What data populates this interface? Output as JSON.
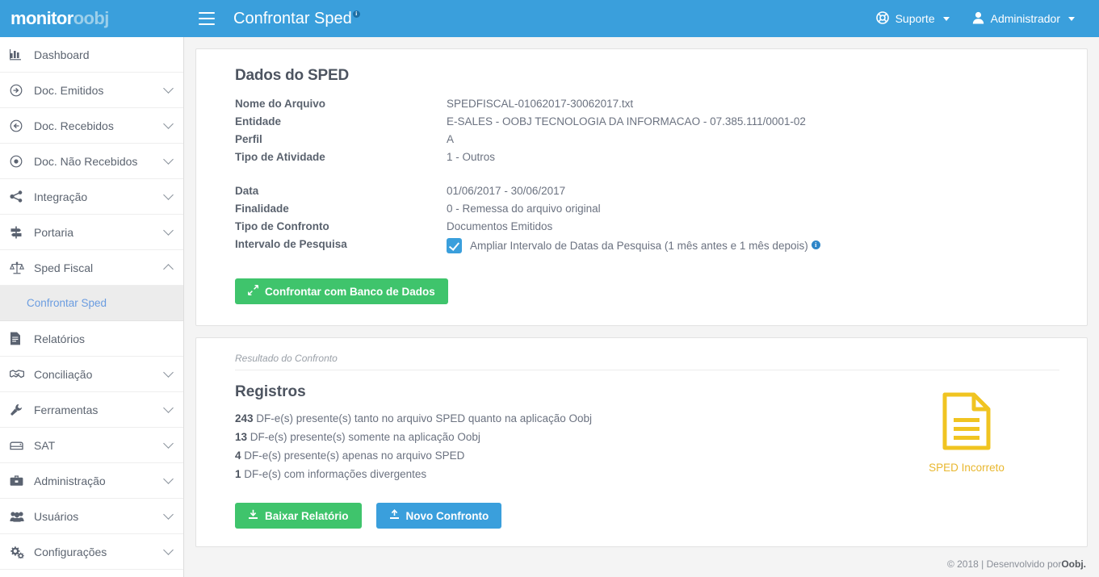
{
  "brand": {
    "part1": "monitor",
    "part2": "oobj"
  },
  "header": {
    "menu_icon": "hamburger-icon",
    "page_title": "Confrontar Sped",
    "title_info_badge": "i",
    "support_label": "Suporte",
    "support_icon": "life-ring-icon",
    "user_label": "Administrador",
    "user_icon": "user-icon",
    "accent_color": "#3a9fdc"
  },
  "sidebar": {
    "items": [
      {
        "label": "Dashboard",
        "icon": "bar-chart-icon",
        "expandable": false
      },
      {
        "label": "Doc. Emitidos",
        "icon": "arrow-circle-right-icon",
        "expandable": true
      },
      {
        "label": "Doc. Recebidos",
        "icon": "arrow-circle-left-icon",
        "expandable": true
      },
      {
        "label": "Doc. Não Recebidos",
        "icon": "dot-circle-icon",
        "expandable": true
      },
      {
        "label": "Integração",
        "icon": "share-nodes-icon",
        "expandable": true
      },
      {
        "label": "Portaria",
        "icon": "signpost-icon",
        "expandable": true
      },
      {
        "label": "Sped Fiscal",
        "icon": "balance-scale-icon",
        "expandable": true,
        "expanded": true
      },
      {
        "label": "Relatórios",
        "icon": "file-lines-icon",
        "expandable": false
      },
      {
        "label": "Conciliação",
        "icon": "handshake-icon",
        "expandable": true
      },
      {
        "label": "Ferramentas",
        "icon": "wrench-icon",
        "expandable": true
      },
      {
        "label": "SAT",
        "icon": "printer-icon",
        "expandable": true
      },
      {
        "label": "Administração",
        "icon": "briefcase-icon",
        "expandable": true
      },
      {
        "label": "Usuários",
        "icon": "users-icon",
        "expandable": true
      },
      {
        "label": "Configurações",
        "icon": "gears-icon",
        "expandable": true
      }
    ],
    "active_sub_item": "Confrontar Sped"
  },
  "sped_card": {
    "title": "Dados do SPED",
    "fields_group1": [
      {
        "label": "Nome do Arquivo",
        "value": "SPEDFISCAL-01062017-30062017.txt"
      },
      {
        "label": "Entidade",
        "value": "E-SALES - OOBJ TECNOLOGIA DA INFORMACAO - 07.385.111/0001-02"
      },
      {
        "label": "Perfil",
        "value": "A"
      },
      {
        "label": "Tipo de Atividade",
        "value": "1 - Outros"
      }
    ],
    "fields_group2": [
      {
        "label": "Data",
        "value": "01/06/2017 - 30/06/2017"
      },
      {
        "label": "Finalidade",
        "value": "0 - Remessa do arquivo original"
      },
      {
        "label": "Tipo de Confronto",
        "value": "Documentos Emitidos"
      }
    ],
    "interval_label": "Intervalo de Pesquisa",
    "interval_checkbox_checked": true,
    "interval_checkbox_text": "Ampliar Intervalo de Datas da Pesquisa (1 mês antes e 1 mês depois)",
    "interval_info_badge": "i",
    "confront_button": {
      "label": "Confrontar com Banco de Dados",
      "icon": "compress-arrows-icon",
      "color": "#3fc46c"
    }
  },
  "result_card": {
    "caption": "Resultado do Confronto",
    "title": "Registros",
    "lines": [
      {
        "count": "243",
        "text": "DF-e(s) presente(s) tanto no arquivo SPED quanto na aplicação Oobj"
      },
      {
        "count": "13",
        "text": "DF-e(s) presente(s) somente na aplicação Oobj"
      },
      {
        "count": "4",
        "text": "DF-e(s) presente(s) apenas no arquivo SPED"
      },
      {
        "count": "1",
        "text": "DF-e(s) com informações divergentes"
      }
    ],
    "status": {
      "label": "SPED Incorreto",
      "icon": "document-warning-icon",
      "color": "#e8b72e"
    },
    "buttons": [
      {
        "label": "Baixar Relatório",
        "icon": "download-icon",
        "color": "#3fc46c"
      },
      {
        "label": "Novo Confronto",
        "icon": "upload-icon",
        "color": "#3a9fdc"
      }
    ]
  },
  "footer": {
    "copyright": "© 2018 | Desenvolvido por ",
    "company": "Oobj."
  }
}
